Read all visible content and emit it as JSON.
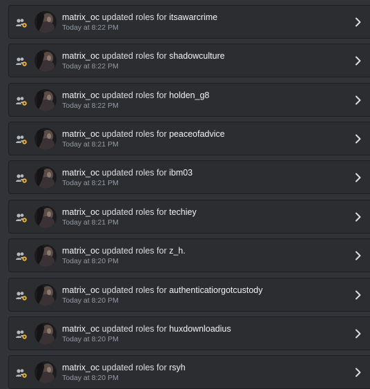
{
  "colors": {
    "background": "#313338",
    "entry_bg": "#2b2d31",
    "text_primary": "#f2f3f5",
    "text_muted": "#949ba4",
    "role_icon": "#b5bac1",
    "role_badge": "#f0b232"
  },
  "icons": {
    "role": "members-role-update-icon",
    "chevron": "chevron-right-icon"
  },
  "entries": [
    {
      "actor": "matrix_oc",
      "action": "updated roles for",
      "target": "itsawarcrime",
      "time": "Today at 8:22 PM"
    },
    {
      "actor": "matrix_oc",
      "action": "updated roles for",
      "target": "shadowculture",
      "time": "Today at 8:22 PM"
    },
    {
      "actor": "matrix_oc",
      "action": "updated roles for",
      "target": "holden_g8",
      "time": "Today at 8:22 PM"
    },
    {
      "actor": "matrix_oc",
      "action": "updated roles for",
      "target": "peaceofadvice",
      "time": "Today at 8:21 PM"
    },
    {
      "actor": "matrix_oc",
      "action": "updated roles for",
      "target": "ibm03",
      "time": "Today at 8:21 PM"
    },
    {
      "actor": "matrix_oc",
      "action": "updated roles for",
      "target": "techiey",
      "time": "Today at 8:21 PM"
    },
    {
      "actor": "matrix_oc",
      "action": "updated roles for",
      "target": "z_h.",
      "time": "Today at 8:20 PM"
    },
    {
      "actor": "matrix_oc",
      "action": "updated roles for",
      "target": "authenticatiorgotcustody",
      "time": "Today at 8:20 PM"
    },
    {
      "actor": "matrix_oc",
      "action": "updated roles for",
      "target": "huxdownloadius",
      "time": "Today at 8:20 PM"
    },
    {
      "actor": "matrix_oc",
      "action": "updated roles for",
      "target": "rsyh",
      "time": "Today at 8:20 PM"
    }
  ]
}
